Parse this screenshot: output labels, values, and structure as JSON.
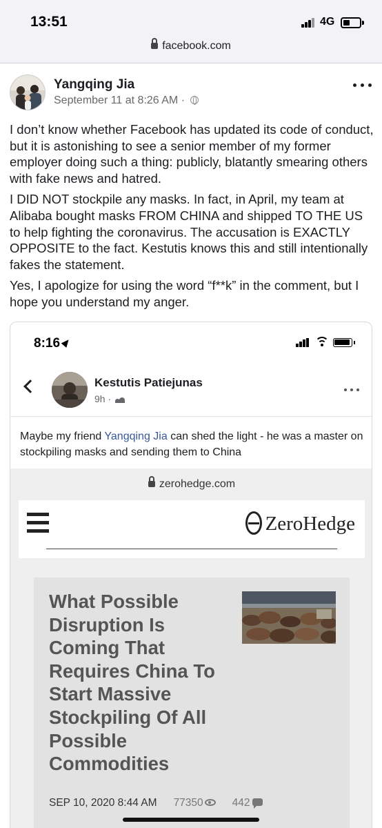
{
  "status_bar": {
    "time": "13:51",
    "network": "4G",
    "url": "facebook.com"
  },
  "post": {
    "author": "Yangqing Jia",
    "meta": "September 11 at 8:26 AM · ",
    "paragraphs": [
      "I don’t know whether Facebook has updated its code of conduct, but it is astonishing to see a senior member of my former employer doing such a thing: publicly, blatantly smearing others with fake news and hatred.",
      "I DID NOT stockpile any masks. In fact, in April, my team at Alibaba bought masks FROM CHINA and shipped TO THE US to help fighting the coronavirus. The accusation is EXACTLY OPPOSITE to the fact. Kestutis knows this and still intentionally fakes the statement.",
      "Yes, I apologize for using the word “f**k” in the comment, but I hope you understand my anger."
    ]
  },
  "embedded": {
    "time": "8:16",
    "author": "Kestutis Patiejunas",
    "meta": "9h · ",
    "text_before": "Maybe my friend ",
    "mention": "Yangqing Jia",
    "text_after": " can shed  the light - he was a master on stockpiling masks and sending them to China",
    "web": {
      "url": "zerohedge.com",
      "logo_text": "ZeroHedge",
      "article_title": "What Possible Disruption Is Coming That Requires China To Start Massive Stockpiling Of All Possible Commodities",
      "date": "SEP 10, 2020 8:44 AM",
      "views": "77350",
      "comments": "442"
    }
  }
}
